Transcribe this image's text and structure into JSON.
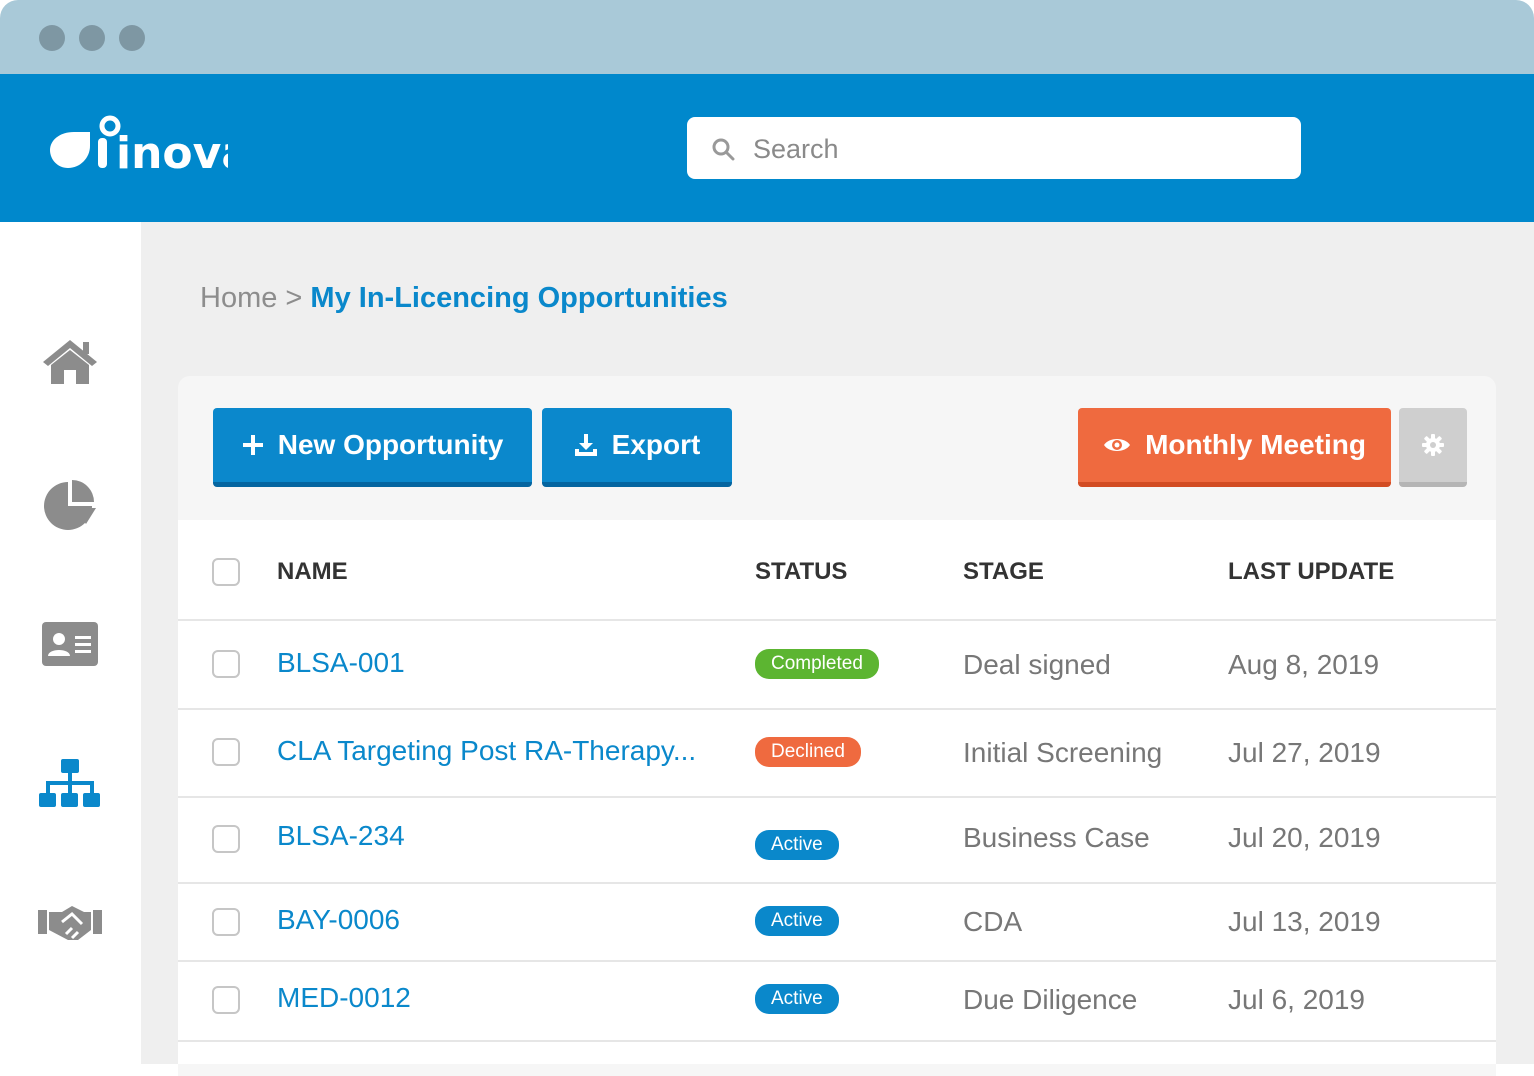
{
  "app": {
    "logo_text": "inova"
  },
  "search": {
    "placeholder": "Search"
  },
  "breadcrumb": {
    "home": "Home",
    "separator": ">",
    "current": "My In-Licencing Opportunities"
  },
  "sidebar": {
    "items": [
      {
        "icon": "home-icon"
      },
      {
        "icon": "pie-chart-icon"
      },
      {
        "icon": "contact-card-icon"
      },
      {
        "icon": "org-chart-icon",
        "active": true
      },
      {
        "icon": "handshake-icon"
      }
    ]
  },
  "toolbar": {
    "new_label": "New Opportunity",
    "export_label": "Export",
    "meeting_label": "Monthly Meeting",
    "settings_icon": "gear-icon"
  },
  "table": {
    "columns": {
      "name": "NAME",
      "status": "STATUS",
      "stage": "STAGE",
      "last_update": "LAST UPDATE"
    },
    "rows": [
      {
        "name": "BLSA-001",
        "status": "Completed",
        "stage": "Deal signed",
        "last_update": "Aug 8, 2019"
      },
      {
        "name": "CLA Targeting Post RA-Therapy...",
        "status": "Declined",
        "stage": "Initial Screening",
        "last_update": "Jul 27, 2019"
      },
      {
        "name": "BLSA-234",
        "status": "Active",
        "stage": "Business Case",
        "last_update": "Jul 20, 2019"
      },
      {
        "name": "BAY-0006",
        "status": "Active",
        "stage": "CDA",
        "last_update": "Jul 13, 2019"
      },
      {
        "name": "MED-0012",
        "status": "Active",
        "stage": "Due Diligence",
        "last_update": "Jul 6, 2019"
      }
    ]
  },
  "colors": {
    "brand": "#0088cc",
    "completed": "#5cb531",
    "declined": "#ef6a3f",
    "active": "#0a88cb"
  }
}
